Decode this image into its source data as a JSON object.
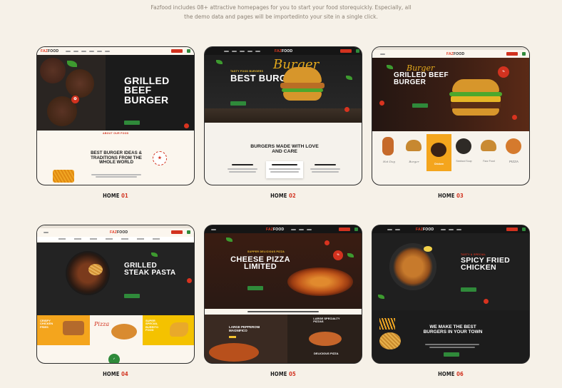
{
  "intro": {
    "line1": "Fazfood includes 08+ attractive homepages for you to start your food storequickly. Especially, all",
    "line2": "the demo data and pages will be importedinto your site in a single click."
  },
  "brand": {
    "logo_prefix": "FAZ",
    "logo_suffix": "FOOD"
  },
  "cards": [
    {
      "caption_label": "HOME",
      "caption_num": "01",
      "title": "GRILLED BEEF BURGER",
      "section_title": "BEST BURGER IDEAS & TRADITIONS FROM THE WHOLE WORLD",
      "kicker": "ABOUT OUR FOOD"
    },
    {
      "caption_label": "HOME",
      "caption_num": "02",
      "title": "BEST BURGERS",
      "script": "Burger",
      "section_title": "BURGERS MADE WITH LOVE AND CARE",
      "kicker": "TASTY FOOD BURGERS"
    },
    {
      "caption_label": "HOME",
      "caption_num": "03",
      "title": "GRILLED BEEF BURGER",
      "script": "Burger",
      "categories": [
        "Hot Dog",
        "Burger",
        "Chicken",
        "Seafood Soup",
        "Fazz Food",
        "PIZZA"
      ]
    },
    {
      "caption_label": "HOME",
      "caption_num": "04",
      "title": "GRILLED STEAK PASTA",
      "promo1": "CRISPY CHICKEN FRIES",
      "promo2": "Pizza",
      "promo3": "SUPER SPECIAL BURRITO FOOD"
    },
    {
      "caption_label": "HOME",
      "caption_num": "05",
      "title": "CHEESE PIZZA LIMITED",
      "kicker": "SUPPER DELICIOUS PIZZA",
      "promo1": "LARGE PEPPERONI MAGNIFICO",
      "promo2": "LARGE SPECIALTY PIZZAS",
      "promo3": "DELICIOUS PIZZA"
    },
    {
      "caption_label": "HOME",
      "caption_num": "06",
      "title": "SPICY FRIED CHICKEN",
      "kicker": "TASTY & SPECIAL",
      "section_title": "WE MAKE THE BEST BURGERS IN YOUR TOWN"
    }
  ],
  "colors": {
    "accent_red": "#d2321f",
    "accent_green": "#2f8a3a",
    "background": "#f6f1e8"
  }
}
